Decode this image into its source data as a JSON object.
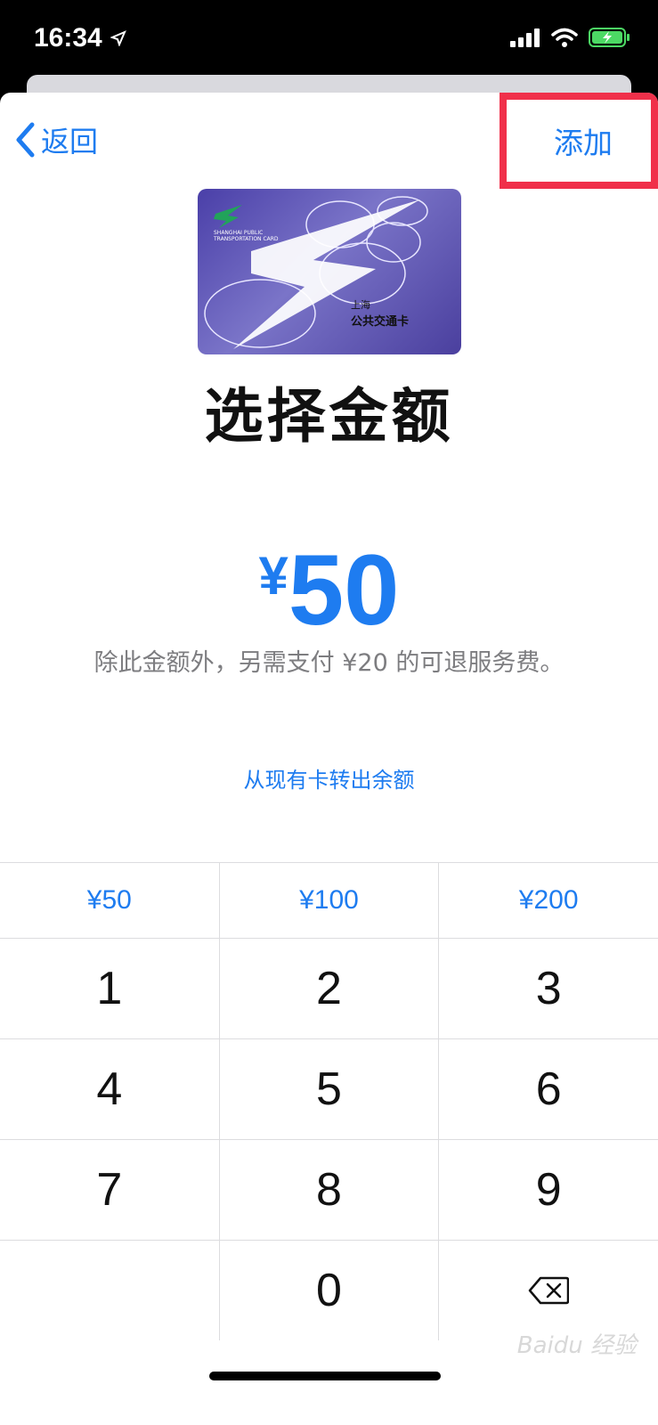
{
  "status_bar": {
    "time": "16:34",
    "icons": [
      "location-arrow-icon",
      "signal-icon",
      "wifi-icon",
      "battery-charging-icon"
    ]
  },
  "nav": {
    "back_label": "返回",
    "add_label": "添加",
    "highlight_color": "#f0304a"
  },
  "card": {
    "name_en": "SHANGHAI PUBLIC TRANSPORTATION CARD",
    "city": "上海",
    "name_zh": "公共交通卡"
  },
  "title": "选择金额",
  "amount": {
    "currency": "¥",
    "value": "50"
  },
  "fee_note": "除此金额外，另需支付 ¥20 的可退服务费。",
  "transfer_link": "从现有卡转出余额",
  "keypad": {
    "presets": [
      "¥50",
      "¥100",
      "¥200"
    ],
    "rows": [
      [
        "1",
        "2",
        "3"
      ],
      [
        "4",
        "5",
        "6"
      ],
      [
        "7",
        "8",
        "9"
      ]
    ],
    "zero": "0",
    "delete_icon": "backspace-icon"
  },
  "watermark": "Baidu 经验",
  "colors": {
    "accent": "#1e7cf0"
  }
}
